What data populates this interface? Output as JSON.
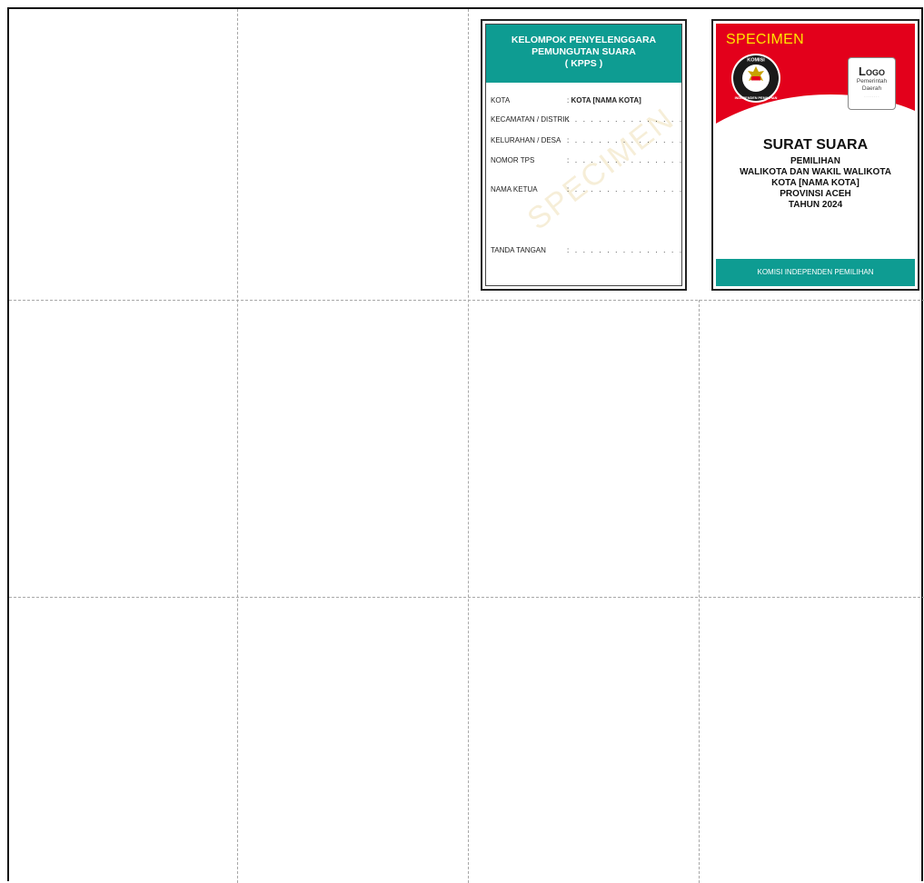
{
  "kpps_card": {
    "header": [
      "KELOMPOK PENYELENGGARA",
      "PEMUNGUTAN SUARA",
      "( KPPS )"
    ],
    "rows": [
      {
        "label": "KOTA",
        "value": "KOTA [NAMA KOTA]"
      },
      {
        "label": "KECAMATAN / DISTRIK",
        "value": ""
      },
      {
        "label": "KELURAHAN / DESA",
        "value": ""
      },
      {
        "label": "NOMOR TPS",
        "value": ""
      },
      {
        "label": "NAMA KETUA",
        "value": ""
      },
      {
        "label": "TANDA TANGAN",
        "value": ""
      }
    ],
    "watermark": "SPECIMEN"
  },
  "ballot_card": {
    "specimen_label": "SPECIMEN",
    "emblem_text_top": "KOMISI",
    "emblem_text_bottom": "INDEPENDEN PEMILIHAN",
    "logo_box": {
      "title": "Logo",
      "subtitle_1": "Pemerintah",
      "subtitle_2": "Daerah"
    },
    "title": "SURAT SUARA",
    "subtitle_lines": [
      "PEMILIHAN",
      "WALIKOTA DAN WAKIL WALIKOTA",
      "KOTA [NAMA KOTA]",
      "PROVINSI ACEH",
      "TAHUN 2024"
    ],
    "footer": "KOMISI INDEPENDEN PEMILIHAN",
    "colors": {
      "red": "#e3001b",
      "teal": "#0e9c92",
      "yellow": "#ffe600"
    }
  }
}
